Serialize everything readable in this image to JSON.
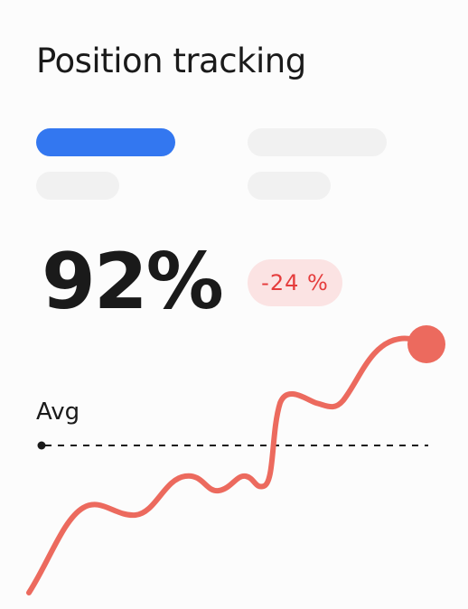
{
  "card": {
    "title": "Position tracking"
  },
  "filters": {
    "active_color": "#3377f0",
    "placeholder_color": "#f1f1f1"
  },
  "summary": {
    "value": "92%",
    "delta": "-24 %",
    "delta_text_color": "#e53c3c",
    "delta_bg_color": "#fbe3e3"
  },
  "chart_data": {
    "type": "line",
    "color": "#ec6a5e",
    "average_label": "Avg",
    "average_line": "dashed",
    "grid": false,
    "legend": "none"
  }
}
